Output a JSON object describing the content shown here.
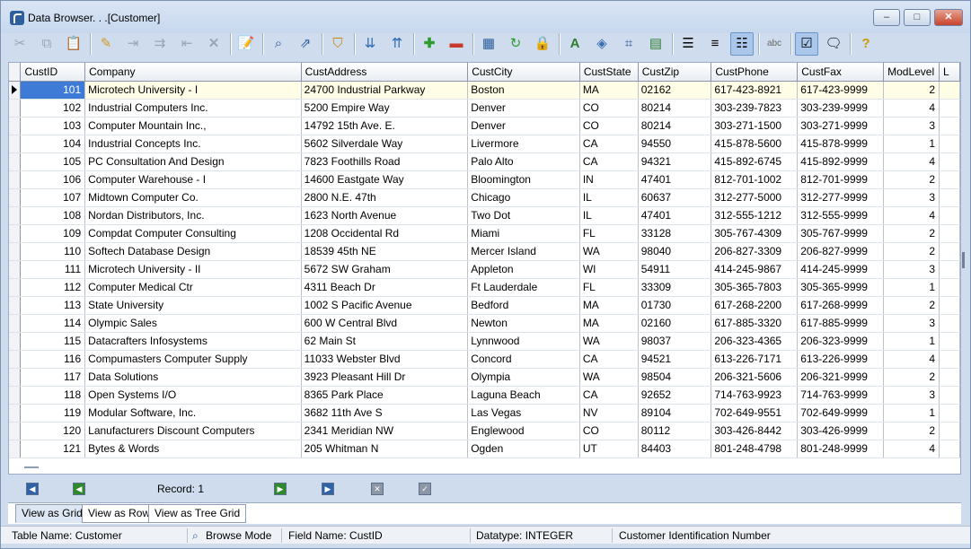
{
  "window": {
    "title": "Data Browser. . .[Customer]",
    "buttons": {
      "minimize": "–",
      "maximize": "□",
      "close": "✕"
    }
  },
  "toolbar": {
    "icons": [
      "cut-icon",
      "copy-icon",
      "paste-icon",
      "edit-pencil-icon",
      "insert-row-icon",
      "append-row-icon",
      "delete-row-icon",
      "delete-x-icon",
      "edit-record-icon",
      "find-icon",
      "find-next-icon",
      "filter-icon",
      "sort-ascending-icon",
      "sort-descending-icon",
      "add-icon",
      "remove-icon",
      "refresh-data-icon",
      "requery-icon",
      "lock-icon",
      "font-icon",
      "fill-color-icon",
      "fit-columns-icon",
      "grid-lines-icon",
      "align-left-icon",
      "align-center-icon",
      "align-justify-icon",
      "spell-check-icon",
      "view-edit-icon",
      "view-options-icon",
      "help-icon"
    ]
  },
  "grid": {
    "columns": [
      "CustID",
      "Company",
      "CustAddress",
      "CustCity",
      "CustState",
      "CustZip",
      "CustPhone",
      "CustFax",
      "ModLevel",
      "L"
    ],
    "rows": [
      [
        "101",
        "Microtech University - I",
        "24700 Industrial Parkway",
        "Boston",
        "MA",
        "02162",
        "617-423-8921",
        "617-423-9999",
        "2"
      ],
      [
        "102",
        "Industrial Computers Inc.",
        "5200 Empire Way",
        "Denver",
        "CO",
        "80214",
        "303-239-7823",
        "303-239-9999",
        "4"
      ],
      [
        "103",
        "Computer Mountain Inc.,",
        "14792 15th Ave. E.",
        "Denver",
        "CO",
        "80214",
        "303-271-1500",
        "303-271-9999",
        "3"
      ],
      [
        "104",
        "Industrial Concepts Inc.",
        "5602 Silverdale Way",
        "Livermore",
        "CA",
        "94550",
        "415-878-5600",
        "415-878-9999",
        "1"
      ],
      [
        "105",
        "PC Consultation And Design",
        "7823 Foothills Road",
        "Palo Alto",
        "CA",
        "94321",
        "415-892-6745",
        "415-892-9999",
        "4"
      ],
      [
        "106",
        "Computer Warehouse - I",
        "14600 Eastgate Way",
        "Bloomington",
        "IN",
        "47401",
        "812-701-1002",
        "812-701-9999",
        "2"
      ],
      [
        "107",
        "Midtown Computer Co.",
        "2800 N.E. 47th",
        "Chicago",
        "IL",
        "60637",
        "312-277-5000",
        "312-277-9999",
        "3"
      ],
      [
        "108",
        "Nordan Distributors, Inc.",
        "1623 North Avenue",
        "Two Dot",
        "IL",
        "47401",
        "312-555-1212",
        "312-555-9999",
        "4"
      ],
      [
        "109",
        "Compdat Computer Consulting",
        "1208 Occidental Rd",
        "Miami",
        "FL",
        "33128",
        "305-767-4309",
        "305-767-9999",
        "2"
      ],
      [
        "110",
        "Softech Database Design",
        "18539 45th NE",
        "Mercer Island",
        "WA",
        "98040",
        "206-827-3309",
        "206-827-9999",
        "2"
      ],
      [
        "111",
        "Microtech University - II",
        "5672 SW Graham",
        "Appleton",
        "WI",
        "54911",
        "414-245-9867",
        "414-245-9999",
        "3"
      ],
      [
        "112",
        "Computer Medical Ctr",
        "4311 Beach Dr",
        "Ft Lauderdale",
        "FL",
        "33309",
        "305-365-7803",
        "305-365-9999",
        "1"
      ],
      [
        "113",
        "State University",
        "1002 S Pacific Avenue",
        "Bedford",
        "MA",
        "01730",
        "617-268-2200",
        "617-268-9999",
        "2"
      ],
      [
        "114",
        "Olympic Sales",
        "600 W Central Blvd",
        "Newton",
        "MA",
        "02160",
        "617-885-3320",
        "617-885-9999",
        "3"
      ],
      [
        "115",
        "Datacrafters Infosystems",
        "62 Main St",
        "Lynnwood",
        "WA",
        "98037",
        "206-323-4365",
        "206-323-9999",
        "1"
      ],
      [
        "116",
        "Compumasters Computer Supply",
        "11033 Webster Blvd",
        "Concord",
        "CA",
        "94521",
        "613-226-7171",
        "613-226-9999",
        "4"
      ],
      [
        "117",
        "Data Solutions",
        "3923 Pleasant Hill Dr",
        "Olympia",
        "WA",
        "98504",
        "206-321-5606",
        "206-321-9999",
        "2"
      ],
      [
        "118",
        "Open Systems I/O",
        "8365 Park Place",
        "Laguna Beach",
        "CA",
        "92652",
        "714-763-9923",
        "714-763-9999",
        "3"
      ],
      [
        "119",
        "Modular Software, Inc.",
        "3682 11th Ave S",
        "Las Vegas",
        "NV",
        "89104",
        "702-649-9551",
        "702-649-9999",
        "1"
      ],
      [
        "120",
        "Lanufacturers Discount Computers",
        "2341 Meridian NW",
        "Englewood",
        "CO",
        "80112",
        "303-426-8442",
        "303-426-9999",
        "2"
      ],
      [
        "121",
        "Bytes & Words",
        "205 Whitman N",
        "Ogden",
        "UT",
        "84403",
        "801-248-4798",
        "801-248-9999",
        "4"
      ]
    ]
  },
  "navigator": {
    "record_label": "Record: 1",
    "icons": {
      "first": "first-record-icon",
      "prior": "prior-record-icon",
      "next": "next-record-icon",
      "last": "last-record-icon",
      "cancel": "cancel-edit-icon",
      "post": "post-edit-icon"
    }
  },
  "view_tabs": [
    "View as Grid",
    "View as Row",
    "View as Tree Grid"
  ],
  "status": {
    "table": "Table Name: Customer",
    "mode": "Browse Mode",
    "field": "Field Name: CustID",
    "datatype": "Datatype: INTEGER",
    "description": "Customer Identification Number"
  }
}
